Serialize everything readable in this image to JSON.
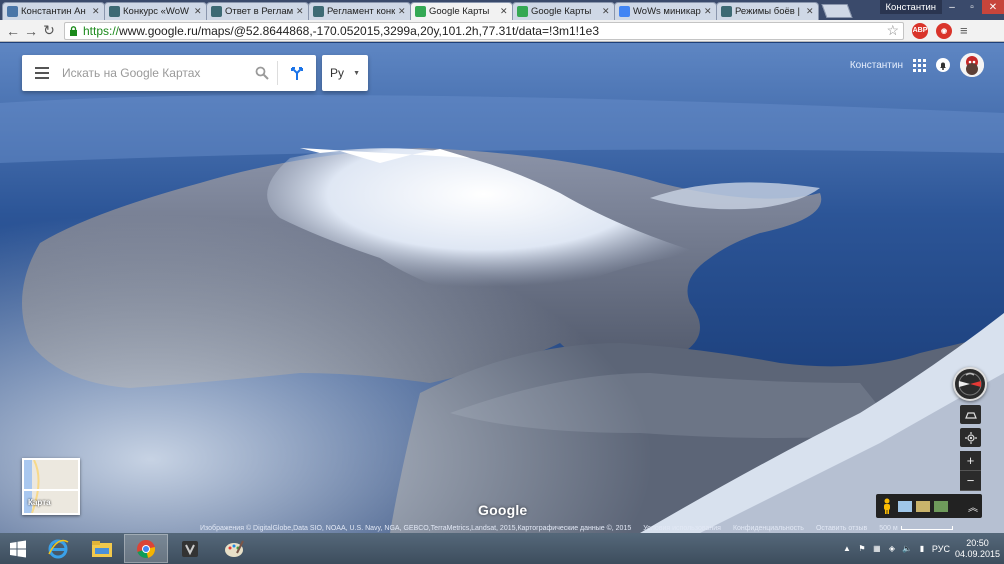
{
  "browser": {
    "tabs": [
      {
        "title": "Константин Ан",
        "icon": "vk-icon",
        "color": "#4a76a8"
      },
      {
        "title": "Конкурс «WoW",
        "icon": "wows-icon",
        "color": "#3d6a74"
      },
      {
        "title": "Ответ в Реглам",
        "icon": "wows-icon",
        "color": "#3d6a74"
      },
      {
        "title": "Регламент конк",
        "icon": "wows-icon",
        "color": "#3d6a74"
      },
      {
        "title": "Google Карты",
        "icon": "maps-icon",
        "color": "#34a853"
      },
      {
        "title": "Google Карты",
        "icon": "maps-icon",
        "color": "#34a853"
      },
      {
        "title": "WoWs миникар",
        "icon": "google-icon",
        "color": "#4285f4"
      },
      {
        "title": "Режимы боёв |",
        "icon": "wows-icon",
        "color": "#3d6a74"
      }
    ],
    "active_tab_index": 4,
    "profile_name": "Константин",
    "url_scheme": "https://",
    "url_rest": "www.google.ru/maps/@52.8644868,-170.052015,3299a,20y,101.2h,77.31t/data=!3m1!1e3"
  },
  "map": {
    "search_placeholder": "Искать на Google Картах",
    "language": "Ру",
    "account_name": "Константин",
    "minimap_label": "Карта",
    "logo": "Google",
    "attribution": "Изображения © DigitalGlobe,Data SIO, NOAA, U.S. Navy, NGA, GEBCO,TerraMetrics,Landsat, 2015,Картографические данные ©, 2015",
    "terms": "Условия использования",
    "privacy": "Конфиденциальность",
    "feedback": "Оставить отзыв",
    "scale_label": "500 м"
  },
  "taskbar": {
    "lang": "РУС",
    "time": "20:50",
    "date": "04.09.2015"
  },
  "colors": {
    "accent": "#4285f4",
    "directions": "#1a73e8"
  }
}
